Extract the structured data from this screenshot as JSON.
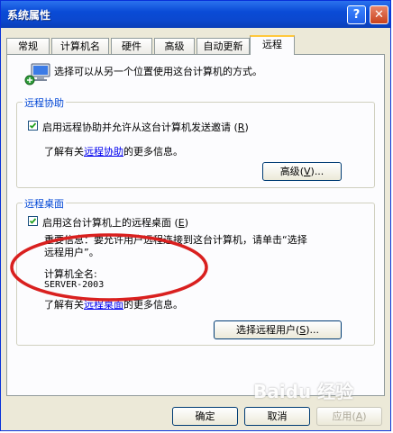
{
  "window": {
    "title": "系统属性",
    "help_glyph": "?",
    "close_glyph": "✕"
  },
  "tabs": [
    {
      "label": "常规",
      "active": false
    },
    {
      "label": "计算机名",
      "active": false
    },
    {
      "label": "硬件",
      "active": false
    },
    {
      "label": "高级",
      "active": false
    },
    {
      "label": "自动更新",
      "active": false
    },
    {
      "label": "远程",
      "active": true
    }
  ],
  "intro": {
    "icon": "computer-network-icon",
    "text": "选择可以从另一个位置使用这台计算机的方式。"
  },
  "remote_assistance": {
    "group_title": "远程协助",
    "checkbox_label": "启用远程协助并允许从这台计算机发送邀请",
    "checkbox_shortcut": "R",
    "checkbox_checked": true,
    "learn_prefix": "了解有关",
    "learn_link": "远程协助",
    "learn_suffix": "的更多信息。",
    "advanced_button": "高级",
    "advanced_shortcut": "V",
    "advanced_ellipsis": "..."
  },
  "remote_desktop": {
    "group_title": "远程桌面",
    "checkbox_label": "启用这台计算机上的远程桌面",
    "checkbox_shortcut": "E",
    "checkbox_checked": true,
    "important_line1": "重要信息：要允许用户远程连接到这台计算机，请单击“选择",
    "important_line2": "远程用户”。",
    "full_name_label": "计算机全名:",
    "full_name_value": "SERVER-2003",
    "learn_prefix": "了解有关",
    "learn_link": "远程桌面",
    "learn_suffix": "的更多信息。",
    "select_users_button": "选择远程用户",
    "select_users_shortcut": "S",
    "select_users_ellipsis": "..."
  },
  "footer": {
    "ok": "确定",
    "cancel": "取消",
    "apply": "应用",
    "apply_shortcut": "A",
    "apply_enabled": false
  },
  "watermark": "Baidu 经验",
  "colors": {
    "titlebar": "#0a4bd6",
    "group_title": "#0046d5",
    "link": "#0000ee",
    "annotation_oval": "#d9201f",
    "checkmark": "#21a121"
  }
}
